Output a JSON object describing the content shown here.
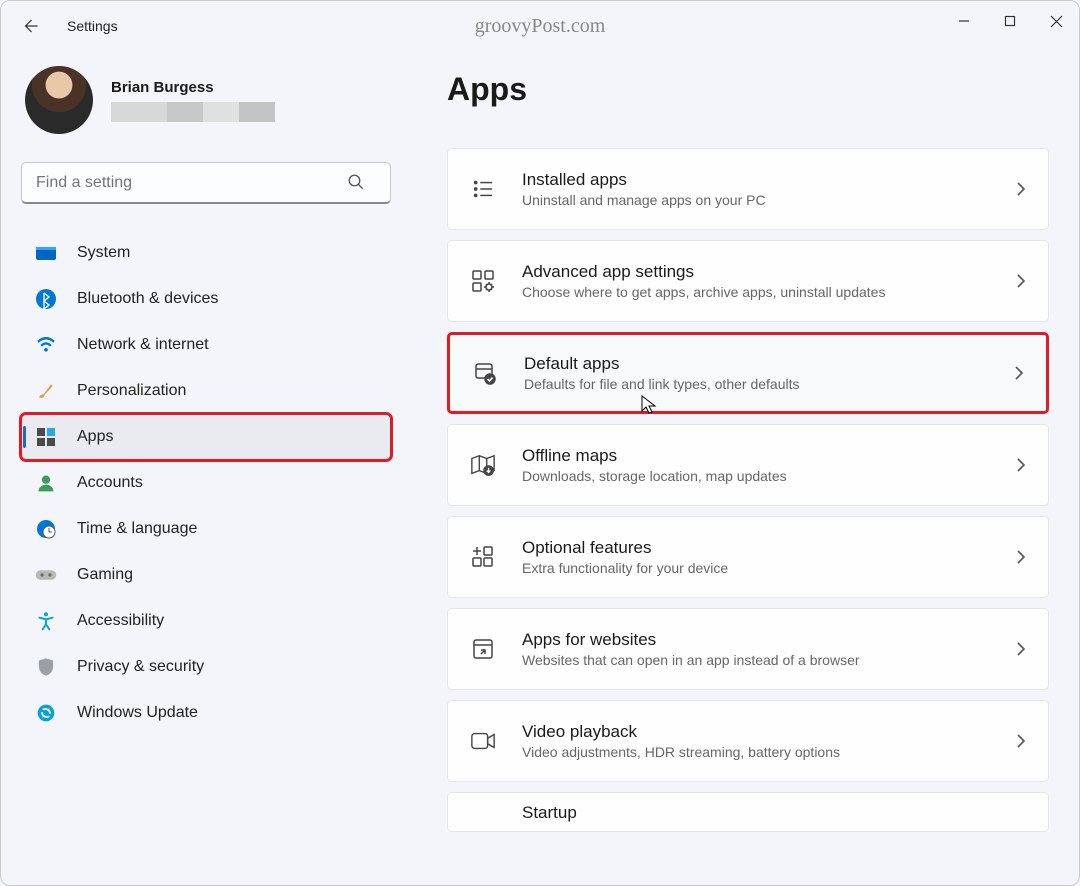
{
  "window": {
    "title": "Settings"
  },
  "watermark": "groovyPost.com",
  "profile": {
    "name": "Brian Burgess"
  },
  "search": {
    "placeholder": "Find a setting"
  },
  "sidebar": {
    "items": [
      {
        "label": "System"
      },
      {
        "label": "Bluetooth & devices"
      },
      {
        "label": "Network & internet"
      },
      {
        "label": "Personalization"
      },
      {
        "label": "Apps"
      },
      {
        "label": "Accounts"
      },
      {
        "label": "Time & language"
      },
      {
        "label": "Gaming"
      },
      {
        "label": "Accessibility"
      },
      {
        "label": "Privacy & security"
      },
      {
        "label": "Windows Update"
      }
    ]
  },
  "page": {
    "title": "Apps"
  },
  "cards": [
    {
      "title": "Installed apps",
      "desc": "Uninstall and manage apps on your PC"
    },
    {
      "title": "Advanced app settings",
      "desc": "Choose where to get apps, archive apps, uninstall updates"
    },
    {
      "title": "Default apps",
      "desc": "Defaults for file and link types, other defaults"
    },
    {
      "title": "Offline maps",
      "desc": "Downloads, storage location, map updates"
    },
    {
      "title": "Optional features",
      "desc": "Extra functionality for your device"
    },
    {
      "title": "Apps for websites",
      "desc": "Websites that can open in an app instead of a browser"
    },
    {
      "title": "Video playback",
      "desc": "Video adjustments, HDR streaming, battery options"
    },
    {
      "title": "Startup",
      "desc": ""
    }
  ],
  "colors": {
    "highlight": "#e01b24",
    "accent": "#1f6cbf"
  }
}
